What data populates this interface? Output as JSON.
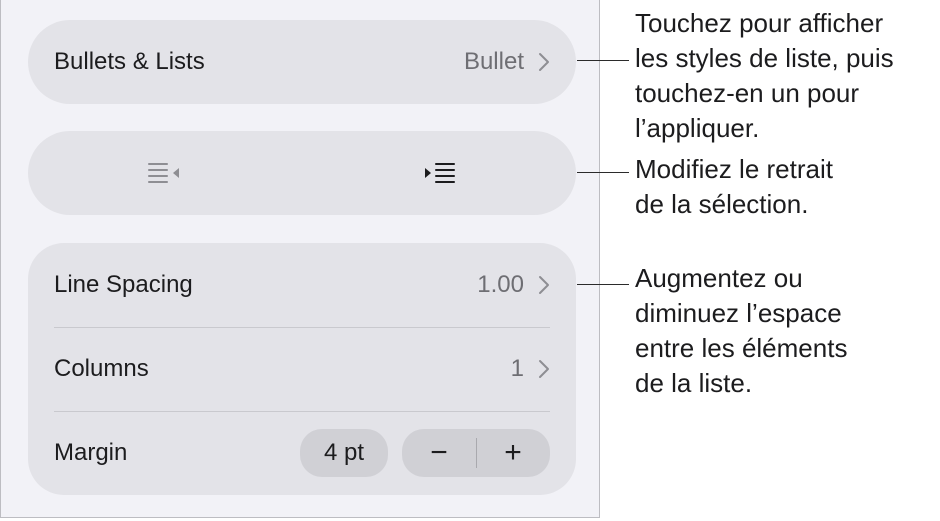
{
  "panel": {
    "bullets": {
      "label": "Bullets & Lists",
      "value": "Bullet"
    },
    "indent": {
      "decrease_icon": "decrease-indent-icon",
      "increase_icon": "increase-indent-icon"
    },
    "line_spacing": {
      "label": "Line Spacing",
      "value": "1.00"
    },
    "columns": {
      "label": "Columns",
      "value": "1"
    },
    "margin": {
      "label": "Margin",
      "value": "4 pt",
      "minus": "−",
      "plus": "+"
    }
  },
  "callouts": {
    "list_styles": [
      "Touchez pour afficher",
      "les styles de liste, puis",
      "touchez-en un pour",
      "l’appliquer."
    ],
    "indent": [
      "Modifiez le retrait",
      "de la sélection."
    ],
    "spacing": [
      "Augmentez ou",
      "diminuez l’espace",
      "entre les éléments",
      "de la liste."
    ]
  },
  "colors": {
    "panel_bg": "#f2f2f7",
    "card_bg": "#e3e3e8",
    "secondary_text": "#6e6e73"
  }
}
